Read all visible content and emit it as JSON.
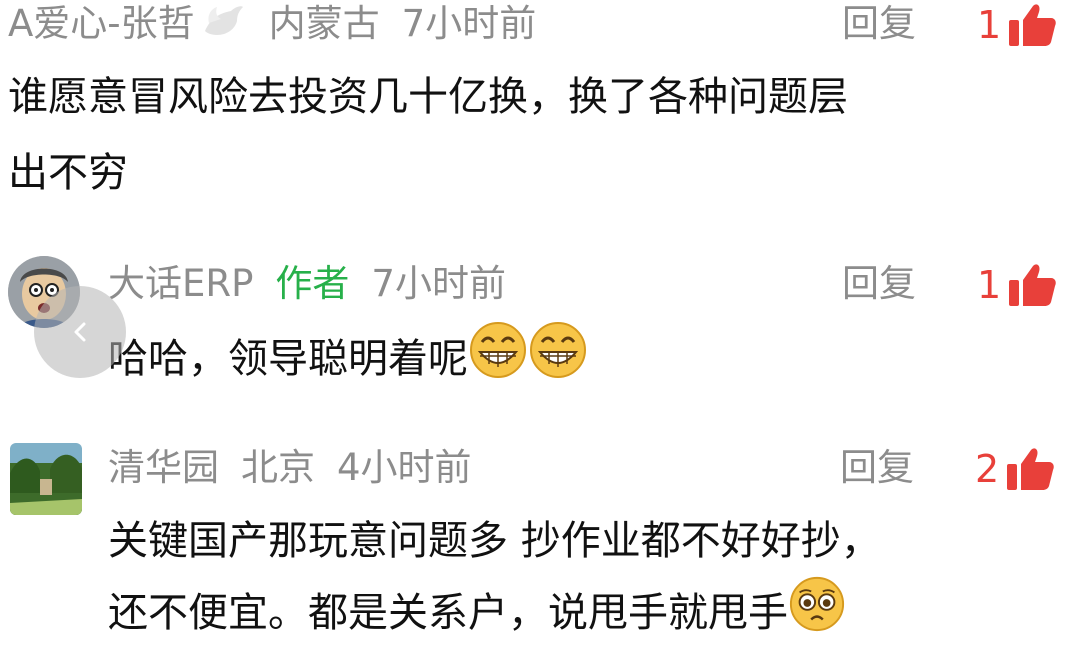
{
  "comments": [
    {
      "user": "A爱心-张哲",
      "location": "内蒙古",
      "time": "7小时前",
      "reply": "回复",
      "likes": "1",
      "lines": [
        "谁愿意冒风险去投资几十亿换，换了各种问题层",
        "出不穷"
      ]
    },
    {
      "user": "大话ERP",
      "badge": "作者",
      "time": "7小时前",
      "reply": "回复",
      "likes": "1",
      "lines": [
        "哈哈，领导聪明着呢"
      ]
    },
    {
      "user": "清华园",
      "location": "北京",
      "time": "4小时前",
      "reply": "回复",
      "likes": "2",
      "lines": [
        "关键国产那玩意问题多 抄作业都不好好抄，",
        "还不便宜。都是关系户，说甩手就甩手"
      ]
    }
  ],
  "colors": {
    "accent_red": "#e8403a",
    "author_green": "#27b04a",
    "meta_gray": "#8c8c8c"
  },
  "icons": [
    "dove-icon",
    "thumbs-up-icon",
    "grin-emoji-icon",
    "pleading-emoji-icon",
    "back-chevron-icon"
  ]
}
